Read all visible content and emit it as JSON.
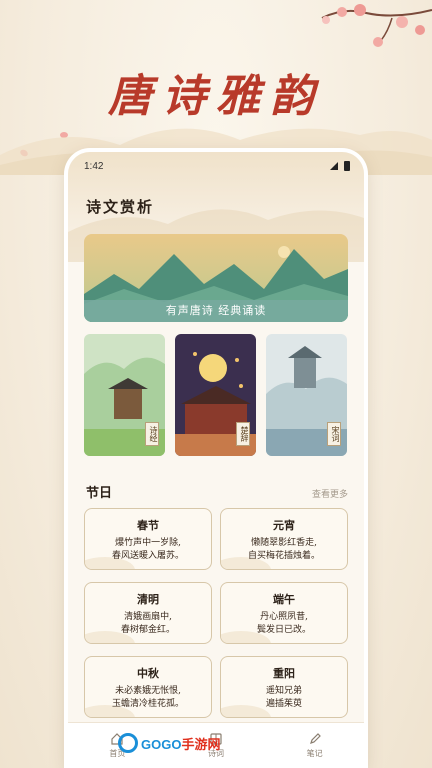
{
  "promo": {
    "title": "唐诗雅韵"
  },
  "status_bar": {
    "time": "1:42"
  },
  "page": {
    "section_title": "诗文赏析"
  },
  "banner": {
    "caption": "有声唐诗 经典诵读"
  },
  "categories": [
    {
      "tag": "诗经"
    },
    {
      "tag": "楚辞"
    },
    {
      "tag": "宋词"
    }
  ],
  "holidays": {
    "title": "节日",
    "see_more": "查看更多",
    "poems": [
      {
        "name": "春节",
        "line1": "爆竹声中一岁除,",
        "line2": "春风送暖入屠苏。"
      },
      {
        "name": "元宵",
        "line1": "懒随翠影红香走,",
        "line2": "自买梅花插烛着。"
      },
      {
        "name": "清明",
        "line1": "清娥画扇中,",
        "line2": "春树郁金红。"
      },
      {
        "name": "端午",
        "line1": "丹心照夙昔,",
        "line2": "鬓发日已改。"
      },
      {
        "name": "中秋",
        "line1": "未必素娥无怅恨,",
        "line2": "玉蟾清冷桂花孤。"
      },
      {
        "name": "重阳",
        "line1": "遥知兄弟",
        "line2": "遍插茱萸"
      }
    ]
  },
  "tabbar": [
    {
      "label": "首页",
      "icon": "home-icon"
    },
    {
      "label": "诗词",
      "icon": "book-icon"
    },
    {
      "label": "笔记",
      "icon": "pen-icon"
    }
  ],
  "watermark": {
    "brand_a": "GOGO",
    "brand_b": "手游网"
  },
  "colors": {
    "accent": "#b83a2a",
    "banner_caption_bg": "#78aaa0",
    "page_bg": "#f6efe3"
  }
}
